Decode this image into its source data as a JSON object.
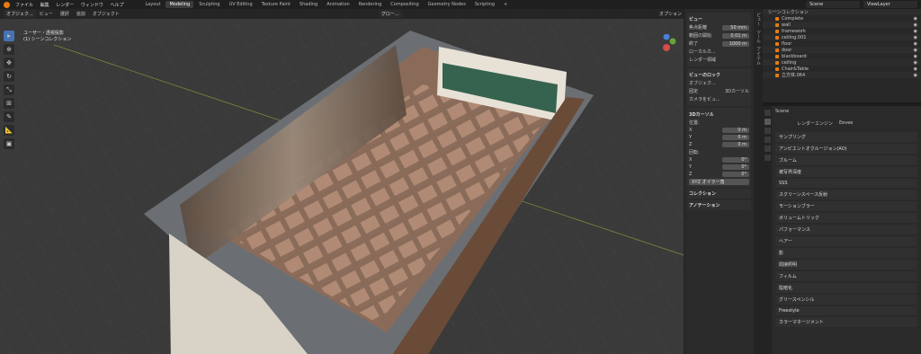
{
  "menu": [
    "ファイル",
    "編集",
    "レンダー",
    "ウィンドウ",
    "ヘルプ"
  ],
  "workspaces": [
    "Layout",
    "Modeling",
    "Sculpting",
    "UV Editing",
    "Texture Paint",
    "Shading",
    "Animation",
    "Rendering",
    "Compositing",
    "Geometry Nodes",
    "Scripting"
  ],
  "active_workspace": "Modeling",
  "scene": "Scene",
  "view_layer": "ViewLayer",
  "viewport_header": {
    "mode": "オブジェク...",
    "menus": [
      "ビュー",
      "選択",
      "追加",
      "オブジェクト"
    ],
    "pivot": "グロー...",
    "options": "オプション"
  },
  "viewport_info": {
    "line1": "ユーザー・透視投影",
    "line2": "(1) シーンコレクション"
  },
  "npanel": {
    "view_header": "ビュー",
    "focal_label": "焦点距離",
    "focal_value": "50 mm",
    "clip_start_label": "範囲の開始",
    "clip_start_value": "0.01 m",
    "clip_end_label": "終了",
    "clip_end_value": "1000 m",
    "local_camera": "ローカルカ...",
    "render_region": "レンダー領域",
    "view_lock": "ビューのロック",
    "object_label": "オブジェク...",
    "lock_label": "固定",
    "lock_3dcursor": "3Dカーソル",
    "camera_view": "カメラをビュ...",
    "cursor_header": "3Dカーソル",
    "location_label": "位置:",
    "x_label": "X",
    "x_value": "0 m",
    "y_label": "Y",
    "y_value": "0 m",
    "z_label": "Z",
    "z_value": "0 m",
    "rotation_label": "回転:",
    "rx_value": "0°",
    "ry_value": "0°",
    "rz_value": "0°",
    "rotation_mode": "XYZ オイラー角",
    "collection": "コレクション",
    "annotation": "アノテーション"
  },
  "tabs": [
    "ビュー",
    "ツール",
    "アイテム"
  ],
  "outliner_title": "シーンコレクション",
  "outliner_items": [
    "Complete",
    "wall",
    "framework",
    "ceiling.001",
    "floor",
    "door",
    "blackboard",
    "ceiling",
    "Chair&Table",
    "立方体.064"
  ],
  "props": {
    "scene_label": "Scene",
    "engine_label": "レンダーエンジン",
    "engine_value": "Eevee",
    "panels": [
      "サンプリング",
      "アンビエントオクルージョン(AO)",
      "ブルーム",
      "被写界深度",
      "SSS",
      "スクリーンスペース反射",
      "モーションブラー",
      "ボリュームトリック",
      "パフォーマンス",
      "ヘアー",
      "影",
      "間接照明",
      "フィルム",
      "陰暗化",
      "グリースペンシル",
      "Freestyle",
      "カラーマネージメント"
    ]
  }
}
